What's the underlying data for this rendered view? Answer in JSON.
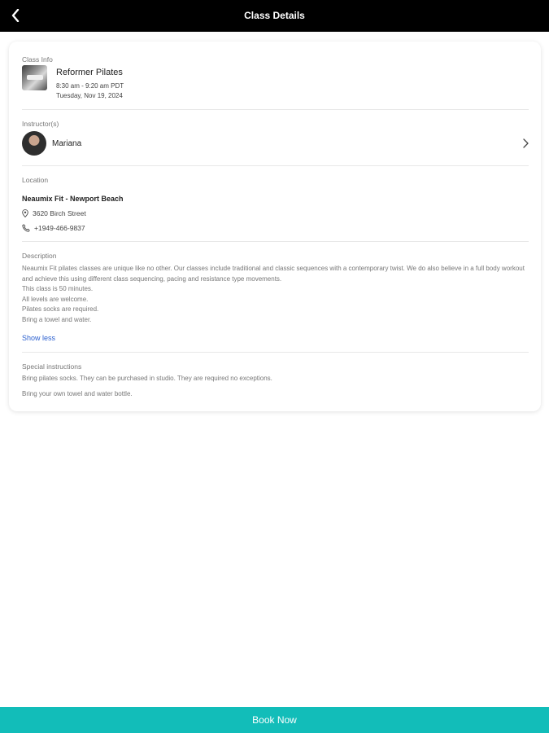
{
  "header": {
    "title": "Class Details"
  },
  "class_info": {
    "label": "Class Info",
    "name": "Reformer Pilates",
    "time": "8:30 am - 9:20 am PDT",
    "date": "Tuesday, Nov 19, 2024"
  },
  "instructors": {
    "label": "Instructor(s)",
    "name": "Mariana"
  },
  "location": {
    "label": "Location",
    "name": "Neaumix Fit - Newport Beach",
    "address": "3620 Birch Street",
    "phone": "+1949-466-9837"
  },
  "description": {
    "label": "Description",
    "paragraph": "Neaumix Fit pilates classes are unique like no other. Our classes include traditional and classic sequences with a contemporary twist. We do also believe in a full body workout and achieve this using different class sequencing, pacing and resistance type movements.",
    "line1": "This class is 50 minutes.",
    "line2": "All levels are welcome.",
    "line3": "Pilates socks are required.",
    "line4": "Bring a towel and water.",
    "toggle_label": "Show less"
  },
  "special_instructions": {
    "label": "Special instructions",
    "line1": "Bring pilates socks. They can be purchased in studio. They are required no exceptions.",
    "line2": "Bring your own towel and water bottle."
  },
  "footer": {
    "book_label": "Book Now"
  },
  "colors": {
    "accent": "#12bdb9",
    "link": "#2a5fcf",
    "header_bg": "#000000"
  }
}
